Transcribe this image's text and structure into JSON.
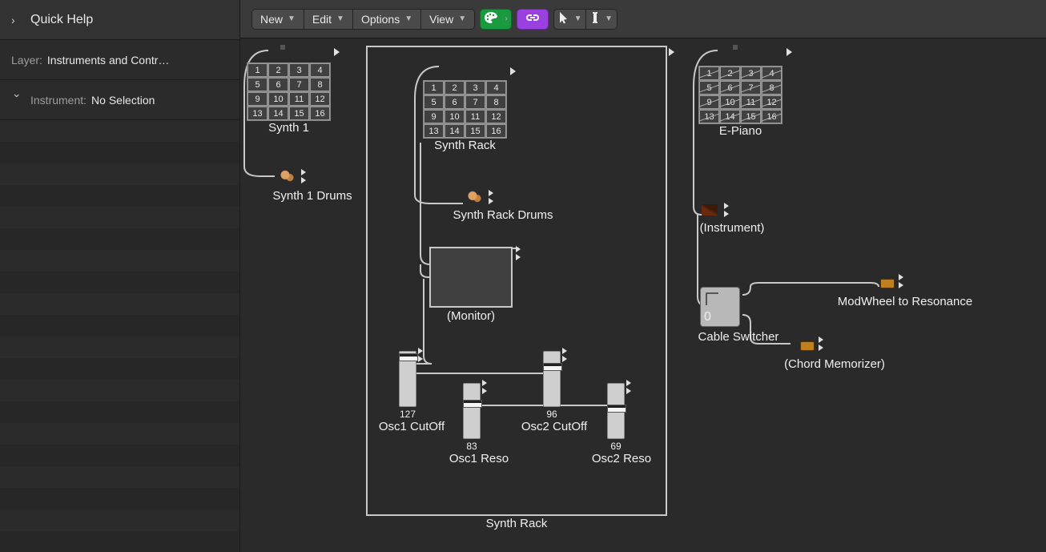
{
  "sidebar": {
    "quick_help_title": "Quick Help",
    "layer_label": "Layer:",
    "layer_value": "Instruments and Contr…",
    "instrument_label": "Instrument:",
    "instrument_value": "No Selection"
  },
  "toolbar": {
    "new": "New",
    "edit": "Edit",
    "options": "Options",
    "view": "View"
  },
  "grid_cells": [
    "1",
    "2",
    "3",
    "4",
    "5",
    "6",
    "7",
    "8",
    "9",
    "10",
    "11",
    "12",
    "13",
    "14",
    "15",
    "16"
  ],
  "nodes": {
    "synth1": {
      "label": "Synth 1"
    },
    "synth1_drums": {
      "label": "Synth 1 Drums"
    },
    "synth_rack": {
      "label": "Synth Rack"
    },
    "synth_rack_drums": {
      "label": "Synth Rack Drums"
    },
    "monitor": {
      "label": "(Monitor)"
    },
    "epianol": {
      "label": "E-Piano"
    },
    "instrument_generic": {
      "label": "(Instrument)"
    },
    "cable_switcher": {
      "label": "Cable Switcher",
      "value": "0"
    },
    "modwheel": {
      "label": "ModWheel to Resonance"
    },
    "chord_mem": {
      "label": "(Chord Memorizer)"
    },
    "container_label": "Synth Rack"
  },
  "faders": {
    "osc1_cutoff": {
      "label": "Osc1 CutOff",
      "value": "127"
    },
    "osc1_reso": {
      "label": "Osc1 Reso",
      "value": "83"
    },
    "osc2_cutoff": {
      "label": "Osc2 CutOff",
      "value": "96"
    },
    "osc2_reso": {
      "label": "Osc2 Reso",
      "value": "69"
    }
  }
}
